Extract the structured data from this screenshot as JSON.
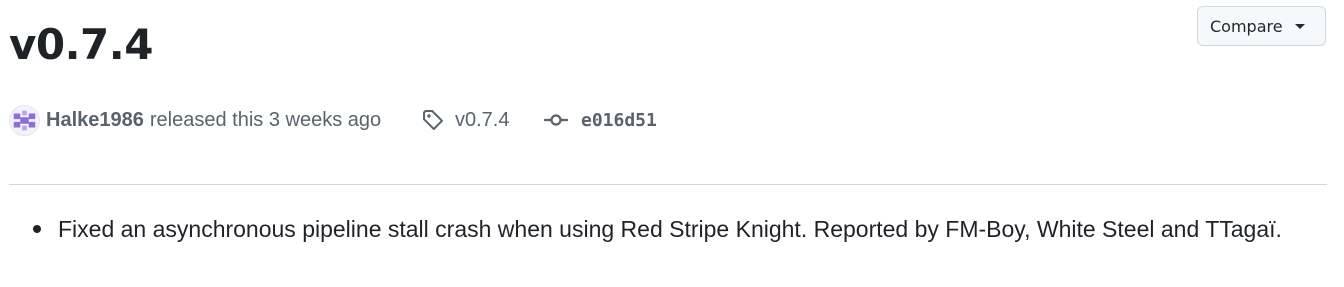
{
  "release": {
    "title": "v0.7.4",
    "author": "Halke1986",
    "released_text": "released this 3 weeks ago",
    "tag": "v0.7.4",
    "commit": "e016d51"
  },
  "header": {
    "compare_label": "Compare"
  },
  "icons": {
    "avatar": "avatar",
    "tag": "tag-icon",
    "commit": "git-commit-icon",
    "compare_caret": "triangle-down-icon"
  },
  "notes": {
    "items": [
      "Fixed an asynchronous pipeline stall crash when using Red Stripe Knight. Reported by FM-Boy, White Steel and TTagaï."
    ]
  },
  "colors": {
    "text_primary": "#1f2328",
    "text_muted": "#59636e",
    "border": "#d1d9e0",
    "button_bg": "#f6f8fa",
    "avatar_accent": "#8b6fd6"
  }
}
